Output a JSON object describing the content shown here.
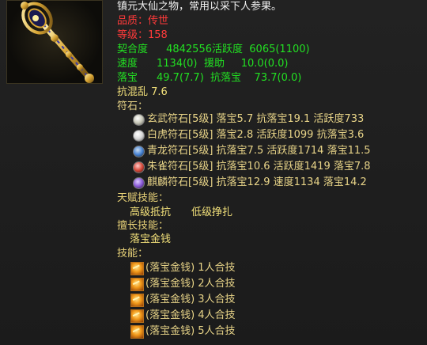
{
  "item": {
    "icon": "ornate-golden-scepter-icon",
    "description": "镇元大仙之物，常用以采下人参果。",
    "quality_label": "品质：",
    "quality": "传世",
    "level_label": "等级：",
    "level": "158"
  },
  "stats": [
    {
      "label": "契合度",
      "v1": "4842556",
      "label2": "活跃度",
      "v2": "6065(1100)"
    },
    {
      "label": "速度",
      "v1": "1134(0)",
      "label2": "援助",
      "v2": "10.0(0.0)"
    },
    {
      "label": "落宝",
      "v1": "49.7(7.7)",
      "label2": "抗落宝",
      "v2": "73.7(0.0)"
    }
  ],
  "extra_stat": "抗混乱 7.6",
  "runes_header": "符石：",
  "runes": [
    {
      "icon": "xuanwu-rune-icon",
      "color": "#c8c8b8",
      "text": "玄武符石[5级] 落宝5.7 抗落宝19.1 活跃度733"
    },
    {
      "icon": "baihu-rune-icon",
      "color": "#d8d8d8",
      "text": "白虎符石[5级] 落宝2.8 活跃度1099 抗落宝3.6"
    },
    {
      "icon": "qinglong-rune-icon",
      "color": "#4a86d8",
      "text": "青龙符石[5级] 抗落宝7.5 活跃度1714 落宝11.5"
    },
    {
      "icon": "zhuque-rune-icon",
      "color": "#d84a3a",
      "text": "朱雀符石[5级] 抗落宝10.6 活跃度1419 落宝7.8"
    },
    {
      "icon": "qilin-rune-icon",
      "color": "#8a5ad8",
      "text": "麒麟符石[5级] 抗落宝12.9 速度1134 落宝14.2"
    }
  ],
  "talent_header": "天赋技能：",
  "talents": [
    "高级抵抗",
    "低级挣扎"
  ],
  "specialty_header": "擅长技能：",
  "specialty": "落宝金钱",
  "skills_header": "技能：",
  "skills": [
    "(落宝金钱) 1人合技",
    "(落宝金钱) 2人合技",
    "(落宝金钱) 3人合技",
    "(落宝金钱) 4人合技",
    "(落宝金钱) 5人合技"
  ]
}
